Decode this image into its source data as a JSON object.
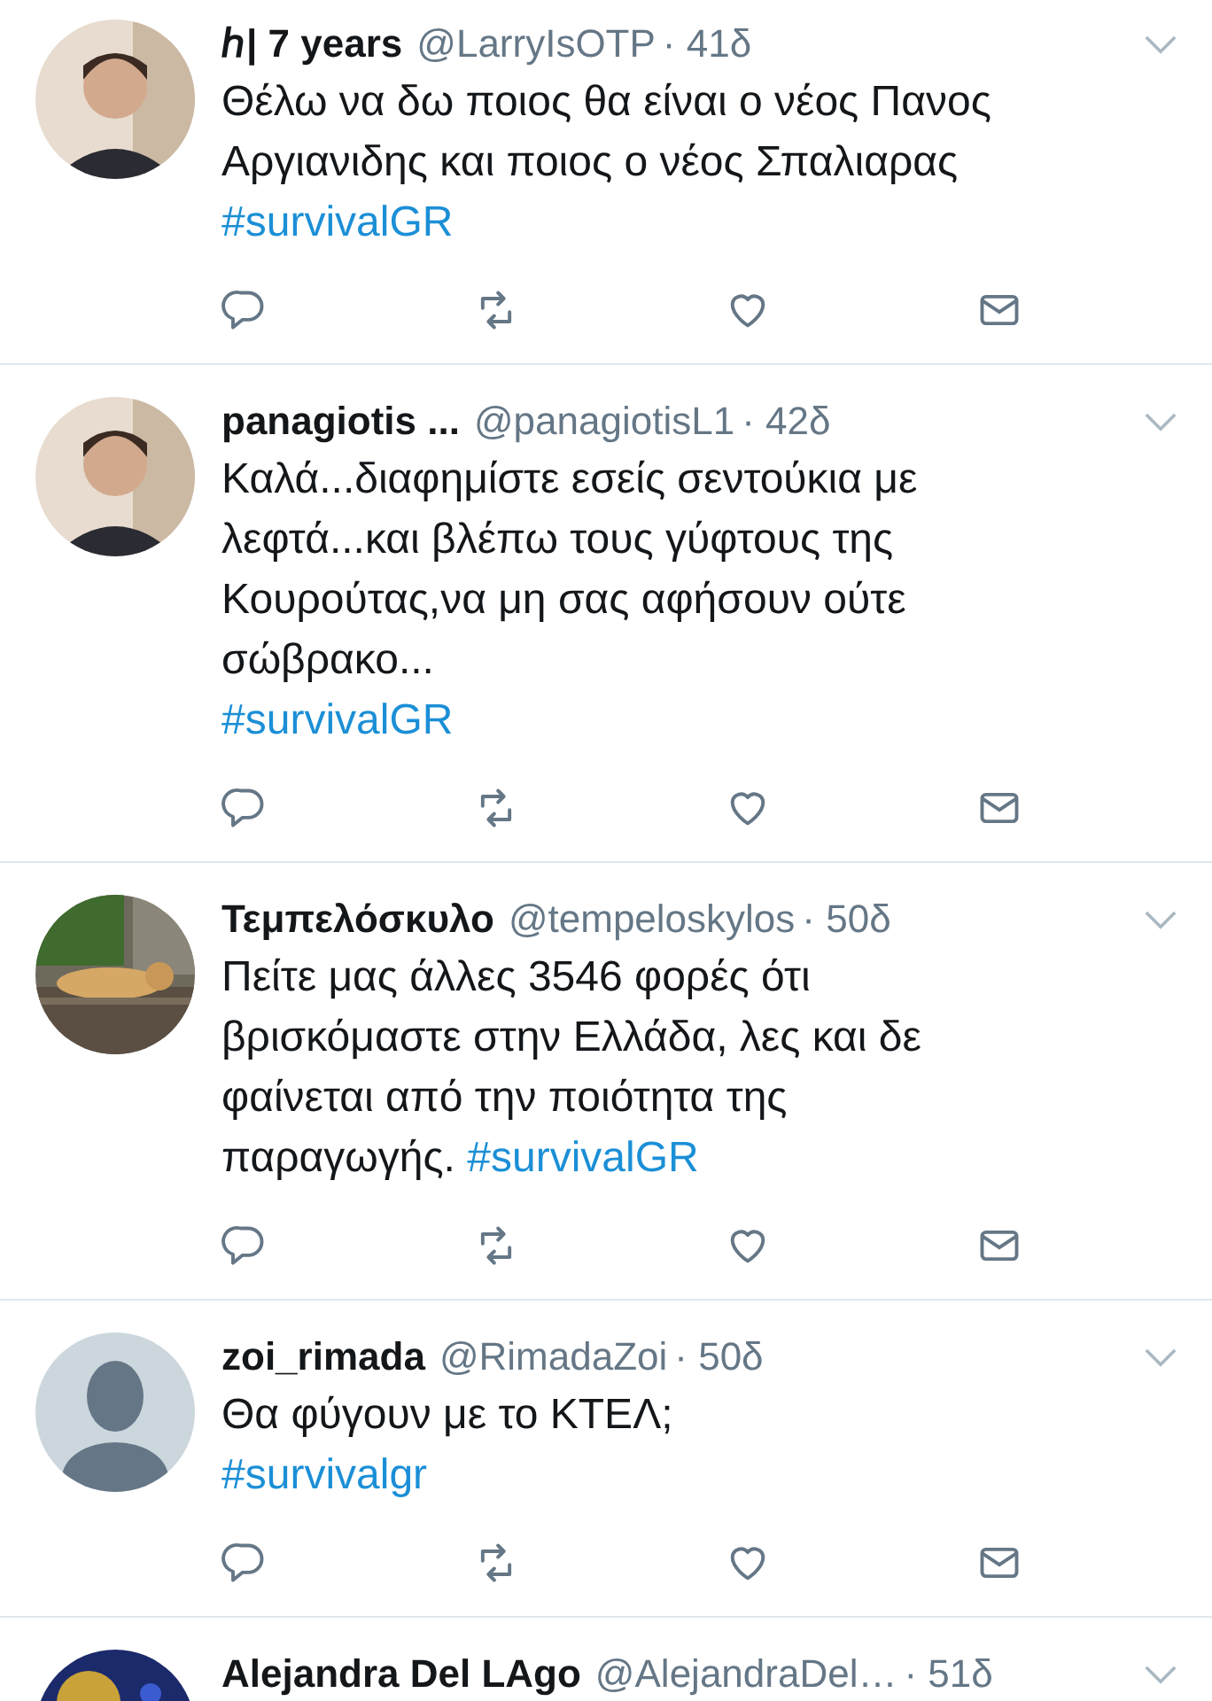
{
  "tweets": [
    {
      "avatar": {
        "kind": "picture"
      },
      "name": "ℎ| 7 years",
      "handle": "@LarryIsOTP",
      "time": "· 41δ",
      "lines": [
        "Θέλω να δω ποιος θα είναι ο νέος Πανος",
        "Αργιανιδης και ποιος ο νέος Σπαλιαρας"
      ],
      "hashtag": "#survivalGR",
      "hashtag_inline": false
    },
    {
      "avatar": {
        "kind": "picture"
      },
      "name": "panagiotis ...",
      "handle": "@panagiotisL1",
      "time": "· 42δ",
      "lines": [
        "Καλά...διαφημίστε εσείς σεντούκια με",
        "λεφτά...και βλέπω τους γύφτους της",
        "Κουρούτας,να μη σας αφήσουν ούτε",
        "σώβρακο..."
      ],
      "hashtag": "#survivalGR",
      "hashtag_inline": false
    },
    {
      "avatar": {
        "kind": "picture"
      },
      "name": "Τεμπελόσκυλο",
      "handle": "@tempeloskylos",
      "time": "· 50δ",
      "lines": [
        "Πείτε μας άλλες 3546 φορές ότι",
        "βρισκόμαστε στην Ελλάδα, λες και δε",
        "φαίνεται από την ποιότητα της",
        "παραγωγής."
      ],
      "hashtag": "#survivalGR",
      "hashtag_inline": true
    },
    {
      "avatar": {
        "kind": "default"
      },
      "name": "zoi_rimada",
      "handle": "@RimadaZoi",
      "time": "· 50δ",
      "lines": [
        "Θα φύγουν με το ΚΤΕΛ;"
      ],
      "hashtag": "#survivalgr",
      "hashtag_inline": false
    },
    {
      "avatar": {
        "kind": "picture"
      },
      "name": "Alejandra Del LAgo",
      "handle": "@AlejandraDel…",
      "time": "· 51δ",
      "partial": true
    }
  ]
}
